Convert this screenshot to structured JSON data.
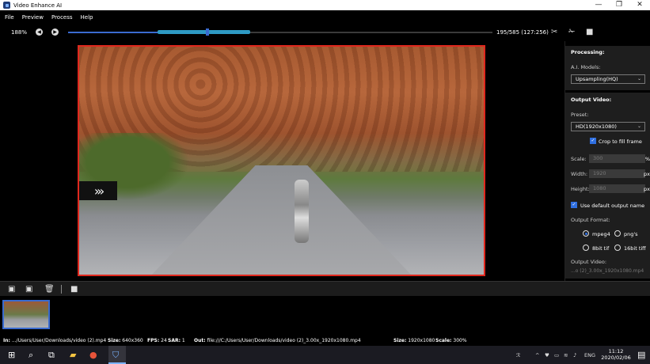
{
  "window": {
    "title": "Video Enhance AI",
    "minimize": "—",
    "maximize": "❐",
    "close": "✕"
  },
  "menu": [
    "File",
    "Preview",
    "Process",
    "Help"
  ],
  "toolbar": {
    "zoom": "188%",
    "frame_counter": "195/585  (127:256)",
    "timeline": {
      "played_fraction": 0.41,
      "range_start_fraction": 0.21,
      "range_end_fraction": 0.43,
      "thumb_fraction": 0.325
    }
  },
  "panel": {
    "processing_title": "Processing:",
    "ai_models_label": "A.I. Models:",
    "ai_model_value": "Upsampling(HQ)",
    "output_video_title": "Output Video:",
    "preset_label": "Preset:",
    "preset_value": "HD(1920x1080)",
    "crop_label": "Crop to fill frame",
    "scale_label": "Scale:",
    "scale_value": "300",
    "scale_unit": "%",
    "width_label": "Width:",
    "width_value": "1920",
    "width_unit": "px",
    "height_label": "Height:",
    "height_value": "1080",
    "height_unit": "px",
    "default_name_label": "Use default output name",
    "format_label": "Output Format:",
    "formats": {
      "mpeg4": "mpeg4",
      "pngs": "png's",
      "tif8": "8bit tif",
      "tif16": "16bit tiff"
    },
    "output_video_label": "Output Video:",
    "output_video_path": "...o (2)_3.00x_1920x1080.mp4"
  },
  "status": {
    "in_label": "In:",
    "in_value": ".../Users/User/Downloads/video (2).mp4",
    "size_label": "Size:",
    "size_value": "640x360",
    "fps_label": "FPS:",
    "fps_value": "24",
    "sar_label": "SAR:",
    "sar_value": "1",
    "out_label": "Out:",
    "out_value": "file:///C:/Users/User/Downloads/video (2)_3.00x_1920x1080.mp4",
    "out_size_label": "Size:",
    "out_size_value": "1920x1080",
    "scale_label": "Scale:",
    "scale_value": "300%"
  },
  "taskbar": {
    "time": "11:12",
    "date": "2020/02/06",
    "language": "ENG"
  },
  "colors": {
    "accent": "#2f6fe0",
    "video_border": "#e0281e",
    "panel_bg": "#1e1e1e"
  }
}
